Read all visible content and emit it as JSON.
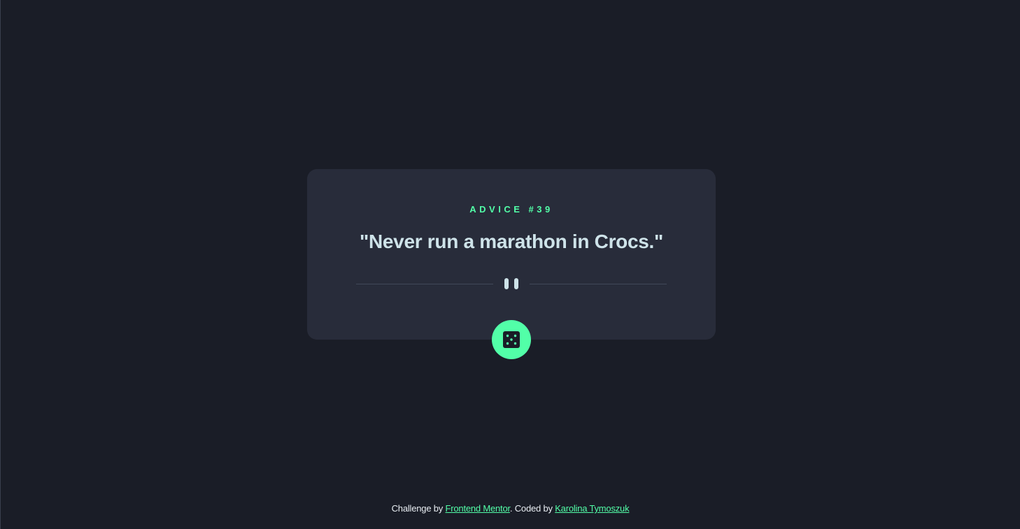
{
  "card": {
    "advice_label": "ADVICE #39",
    "advice_text": "\"Never run a marathon in Crocs.\""
  },
  "button": {
    "icon": "dice-icon",
    "icon_color": "#1a1d27"
  },
  "footer": {
    "prefix": "Challenge by ",
    "mentor_link": "Frontend Mentor",
    "middle": ". Coded by ",
    "author_link": "Karolina Tymoszuk"
  },
  "colors": {
    "background": "#1a1d27",
    "card": "#282c3a",
    "accent": "#52ffa8",
    "text": "#cee3e9"
  }
}
